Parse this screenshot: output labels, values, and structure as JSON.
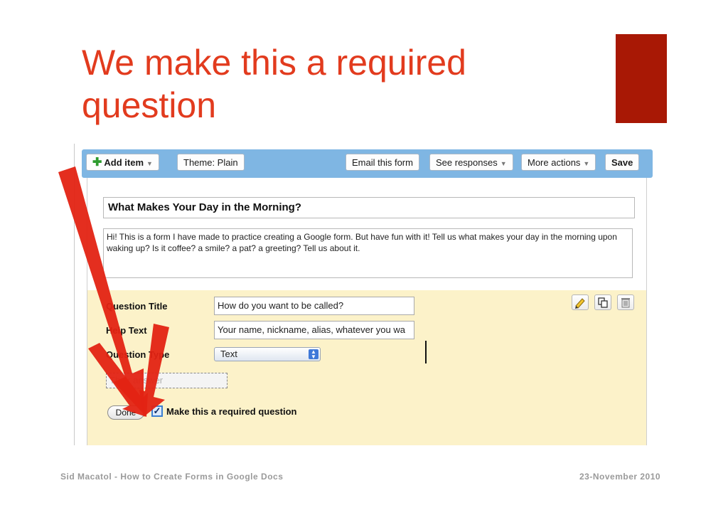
{
  "slide": {
    "title": "We make this a required question",
    "footer_left": "Sid Macatol - How to Create Forms in Google Docs",
    "footer_right": "23-November 2010",
    "accent_color": "#e23b1e",
    "block_color": "#a81805"
  },
  "toolbar": {
    "add_item": "Add item",
    "theme": "Theme:  Plain",
    "email_form": "Email this form",
    "see_responses": "See responses",
    "more_actions": "More actions",
    "save": "Save"
  },
  "form": {
    "title": "What Makes Your Day in the Morning?",
    "description": "Hi! This is a form I have made to practice creating a Google form. But have fun with it! Tell us what makes your day in the morning upon waking up? Is it coffee? a smile? a pat? a greeting? Tell us about it."
  },
  "question": {
    "title_label": "Question Title",
    "title_value": "How do you want to be called?",
    "help_label": "Help Text",
    "help_value": "Your name, nickname, alias, whatever you wa",
    "type_label": "Question Type",
    "type_value": "Text",
    "preview_placeholder": "Their answer",
    "done_label": "Done",
    "required_label": "Make this a required question",
    "required_checked": true
  },
  "icons": [
    "plus-icon",
    "pencil-icon",
    "duplicate-icon",
    "trash-icon",
    "select-arrows-icon",
    "arrow-annotation-icon"
  ]
}
